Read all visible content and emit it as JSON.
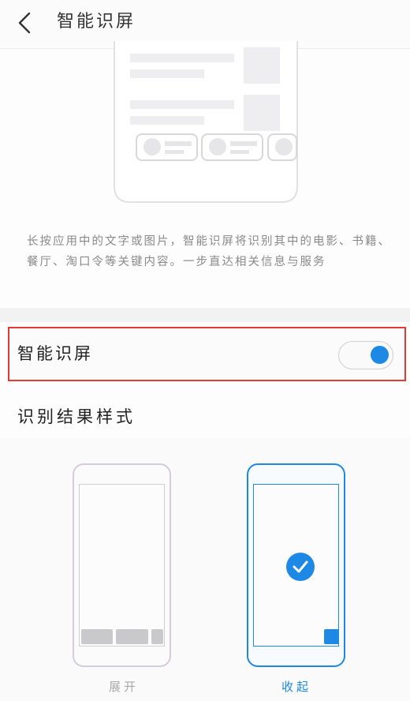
{
  "header": {
    "title": "智能识屏",
    "back_icon": "chevron-left-icon"
  },
  "intro": {
    "description": "长按应用中的文字或图片，智能识屏将识别其中的电影、书籍、餐厅、淘口令等关键内容。一步直达相关信息与服务"
  },
  "toggle": {
    "label": "智能识屏",
    "enabled": true
  },
  "result_style": {
    "title": "识别结果样式",
    "options": [
      {
        "label": "展开",
        "selected": false
      },
      {
        "label": "收起",
        "selected": true
      }
    ]
  },
  "colors": {
    "accent": "#1e88e5",
    "highlight_border": "#e53935"
  }
}
